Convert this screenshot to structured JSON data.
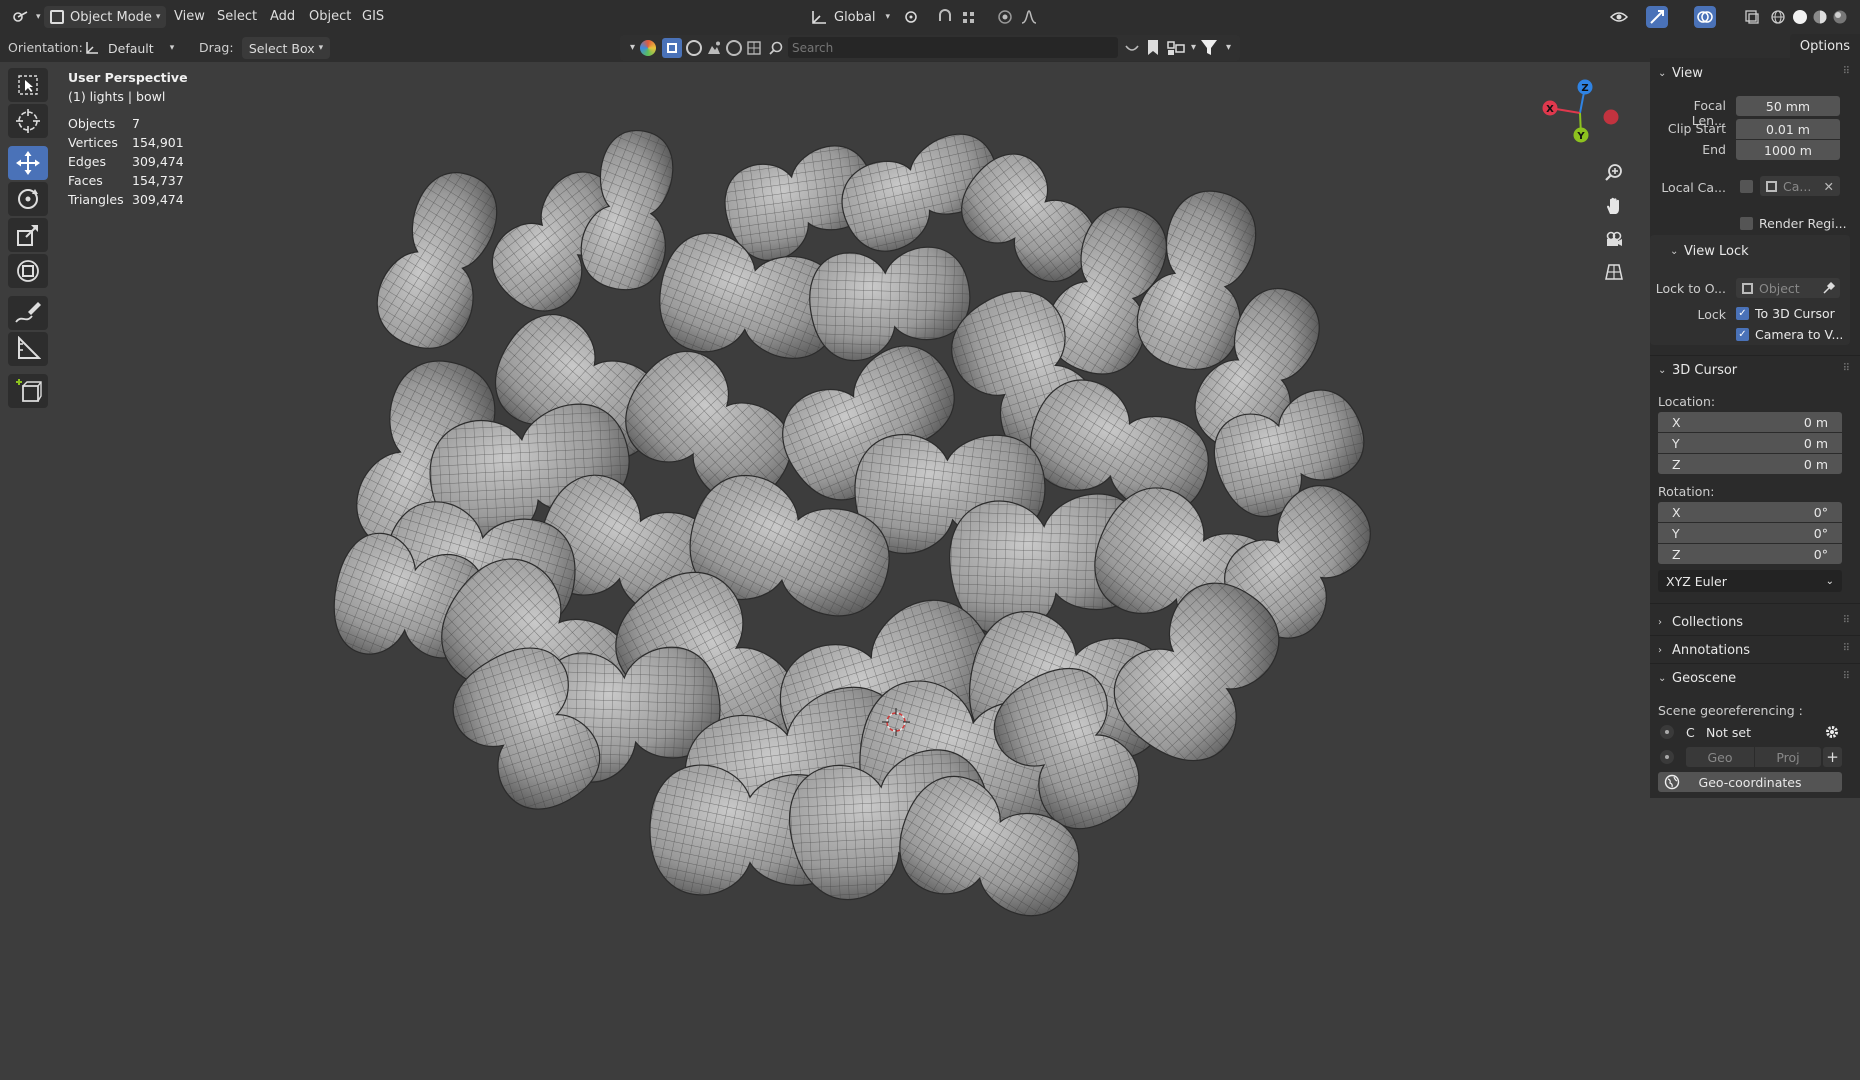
{
  "header": {
    "mode_label": "Object Mode",
    "menus": [
      "View",
      "Select",
      "Add",
      "Object",
      "GIS"
    ],
    "transform_orientation": "Global"
  },
  "toolrow": {
    "orientation_label": "Orientation:",
    "orientation_value": "Default",
    "drag_label": "Drag:",
    "drag_value": "Select Box",
    "search_placeholder": "Search",
    "options_label": "Options"
  },
  "stats": {
    "view_name": "User Perspective",
    "context": "(1) lights | bowl",
    "rows": [
      {
        "key": "Objects",
        "value": "7"
      },
      {
        "key": "Vertices",
        "value": "154,901"
      },
      {
        "key": "Edges",
        "value": "309,474"
      },
      {
        "key": "Faces",
        "value": "154,737"
      },
      {
        "key": "Triangles",
        "value": "309,474"
      }
    ]
  },
  "gizmo": {
    "x": "X",
    "y": "Y",
    "z": "Z"
  },
  "sidebar": {
    "view": {
      "title": "View",
      "focal_label": "Focal Len...",
      "focal_value": "50 mm",
      "clip_start_label": "Clip Start",
      "clip_start_value": "0.01 m",
      "clip_end_label": "End",
      "clip_end_value": "1000 m",
      "local_camera_label": "Local Ca...",
      "local_camera_value": "Ca...",
      "render_region_label": "Render Regi..."
    },
    "view_lock": {
      "title": "View Lock",
      "lock_to_label": "Lock to O...",
      "lock_to_placeholder": "Object",
      "lock_label": "Lock",
      "to_cursor_label": "To 3D Cursor",
      "camera_to_view_label": "Camera to V..."
    },
    "cursor": {
      "title": "3D Cursor",
      "location_label": "Location:",
      "location": [
        {
          "axis": "X",
          "value": "0 m"
        },
        {
          "axis": "Y",
          "value": "0 m"
        },
        {
          "axis": "Z",
          "value": "0 m"
        }
      ],
      "rotation_label": "Rotation:",
      "rotation": [
        {
          "axis": "X",
          "value": "0°"
        },
        {
          "axis": "Y",
          "value": "0°"
        },
        {
          "axis": "Z",
          "value": "0°"
        }
      ],
      "rotation_mode": "XYZ Euler"
    },
    "collections_title": "Collections",
    "annotations_title": "Annotations",
    "geoscene": {
      "title": "Geoscene",
      "georef_label": "Scene georeferencing :",
      "crs_letter": "C",
      "crs_status": "Not set",
      "geo_label": "Geo",
      "proj_label": "Proj",
      "geocoords_label": "Geo-coordinates"
    }
  },
  "colors": {
    "accent": "#4a72b8",
    "background": "#3d3d3d",
    "header": "#2e2e2e",
    "axis_x": "#e0384d",
    "axis_y": "#8dc21f",
    "axis_z": "#2f83e3"
  }
}
